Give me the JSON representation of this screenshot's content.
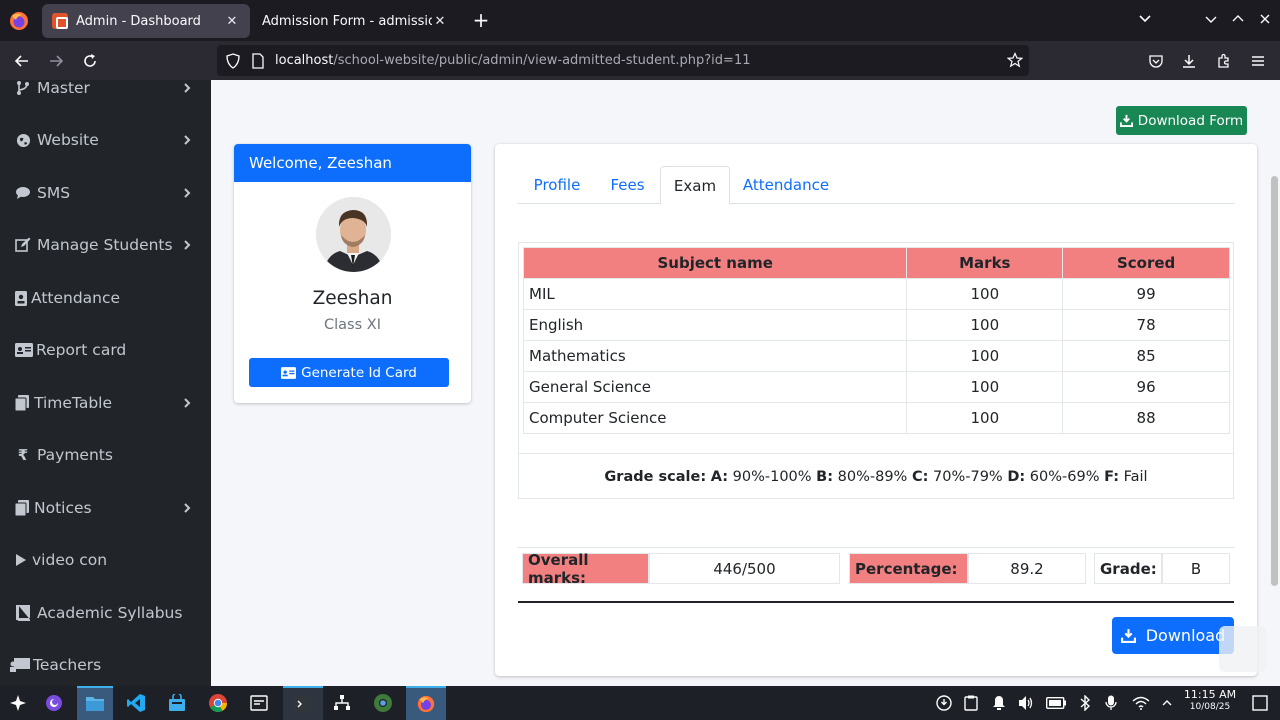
{
  "browser": {
    "tabs": [
      {
        "title": "Admin - Dashboard",
        "active": true
      },
      {
        "title": "Admission Form - admission_f",
        "active": false
      }
    ],
    "url_host": "localhost",
    "url_path": "/school-website/public/admin/view-admitted-student.php?id=11"
  },
  "sidebar": {
    "items": [
      {
        "label": "Master",
        "icon": "code-branch-icon",
        "has_submenu": true
      },
      {
        "label": "Website",
        "icon": "globe-icon",
        "has_submenu": true
      },
      {
        "label": "SMS",
        "icon": "comment-icon",
        "has_submenu": true
      },
      {
        "label": "Manage Students",
        "icon": "edit-icon",
        "has_submenu": true
      },
      {
        "label": "Attendance",
        "icon": "id-badge-icon",
        "has_submenu": false
      },
      {
        "label": "Report card",
        "icon": "id-card-icon",
        "has_submenu": false
      },
      {
        "label": "TimeTable",
        "icon": "copy-icon",
        "has_submenu": true
      },
      {
        "label": "Payments",
        "icon": "rupee-icon",
        "has_submenu": false
      },
      {
        "label": "Notices",
        "icon": "copy-icon",
        "has_submenu": true
      },
      {
        "label": "video con",
        "icon": "play-icon",
        "has_submenu": false
      },
      {
        "label": "Academic Syllabus",
        "icon": "book-icon",
        "has_submenu": false
      },
      {
        "label": "Teachers",
        "icon": "chalkboard-icon",
        "has_submenu": false
      }
    ]
  },
  "page": {
    "download_form_label": "Download Form",
    "profile_card": {
      "welcome": "Welcome, Zeeshan",
      "name": "Zeeshan",
      "class": "Class XI",
      "generate_id_label": "Generate Id Card"
    },
    "tabs": [
      "Profile",
      "Fees",
      "Exam",
      "Attendance"
    ],
    "active_tab": "Exam",
    "exam_table": {
      "headers": [
        "Subject name",
        "Marks",
        "Scored"
      ],
      "rows": [
        [
          "MIL",
          "100",
          "99"
        ],
        [
          "English",
          "100",
          "78"
        ],
        [
          "Mathematics",
          "100",
          "85"
        ],
        [
          "General Science",
          "100",
          "96"
        ],
        [
          "Computer Science",
          "100",
          "88"
        ]
      ]
    },
    "grade_scale": {
      "prefix": "Grade scale:",
      "items": [
        {
          "g": "A:",
          "r": "90%-100%"
        },
        {
          "g": "B:",
          "r": "80%-89%"
        },
        {
          "g": "C:",
          "r": "70%-79%"
        },
        {
          "g": "D:",
          "r": "60%-69%"
        },
        {
          "g": "F:",
          "r": "Fail"
        }
      ]
    },
    "summary": {
      "overall_label": "Overall marks:",
      "overall_value": "446/500",
      "percentage_label": "Percentage:",
      "percentage_value": "89.2",
      "grade_label": "Grade:",
      "grade_value": "B"
    },
    "download_label": "Download"
  },
  "taskbar": {
    "time": "11:15 AM",
    "date": "10/08/25"
  },
  "colors": {
    "primary": "#0d6efd",
    "success": "#198754",
    "header_red": "#f28080",
    "sidebar_bg": "#212529"
  }
}
